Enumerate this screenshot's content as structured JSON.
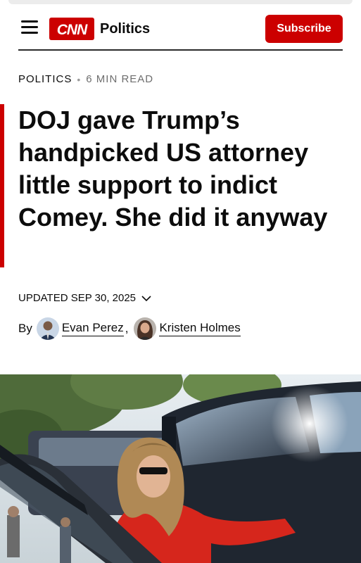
{
  "header": {
    "logo_text": "CNN",
    "section": "Politics",
    "subscribe_label": "Subscribe",
    "brand_color": "#cc0000"
  },
  "article": {
    "category": "POLITICS",
    "separator": "•",
    "read_time": "6 MIN READ",
    "headline": "DOJ gave Trump’s handpicked US attorney little support to indict Comey. She did it anyway",
    "updated": "UPDATED SEP 30, 2025",
    "byline_prefix": "By",
    "authors": [
      {
        "name": "Evan Perez"
      },
      {
        "name": "Kristen Holmes"
      }
    ],
    "author_separator": ","
  },
  "icons": {
    "menu": "hamburger-menu-icon",
    "updated_toggle": "chevron-down-icon"
  }
}
